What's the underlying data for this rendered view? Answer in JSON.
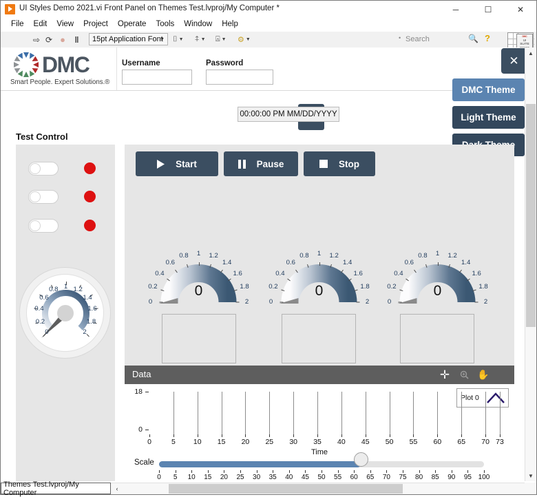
{
  "window": {
    "title": "UI Styles Demo 2021.vi Front Panel on Themes Test.lvproj/My Computer *",
    "app_icon": "labview-icon",
    "minimize": "─",
    "maximize": "☐",
    "close": "✕"
  },
  "menu": {
    "items": [
      "File",
      "Edit",
      "View",
      "Project",
      "Operate",
      "Tools",
      "Window",
      "Help"
    ]
  },
  "toolbar": {
    "run": "⇨",
    "run_continuous": "⟳",
    "abort": "●",
    "pause": "‖",
    "font_selector": "15pt Application Font",
    "caret": "▼",
    "align_objects": "⌷",
    "distribute_objects": "⍏",
    "resize_objects": "⍓",
    "reorder": "⚙",
    "search_divider": "•",
    "search_placeholder": "Search",
    "search_icon": "search-icon",
    "help_icon": "?",
    "vi_icon_line1": "UI",
    "vi_icon_line2": "SUITE",
    "vi_icon_line3": "DEMO",
    "vi_icon_brand": "DMC"
  },
  "header": {
    "logo_text": "DMC",
    "logo_tagline": "Smart People. Expert Solutions.®",
    "username_label": "Username",
    "username_value": "",
    "password_label": "Password",
    "password_value": "",
    "user_button_icon": "user-icon",
    "timestamp": "00:00:00 PM MM/DD/YYYY",
    "close_button": "✕"
  },
  "themes": {
    "buttons": [
      {
        "label": "DMC Theme",
        "color": "#5b84b1",
        "selected": true
      },
      {
        "label": "Light Theme",
        "color": "#33475c",
        "selected": false
      },
      {
        "label": "Dark Theme",
        "color": "#33475c",
        "selected": false
      }
    ]
  },
  "test_control": {
    "title": "Test Control",
    "toggles": [
      {
        "state": "off"
      },
      {
        "state": "off"
      },
      {
        "state": "off"
      }
    ],
    "leds": [
      {
        "color": "#dd1111",
        "state": "on"
      },
      {
        "color": "#dd1111",
        "state": "on"
      },
      {
        "color": "#dd1111",
        "state": "on"
      }
    ],
    "knob": {
      "value": 0,
      "min": 0,
      "max": 2,
      "tick_labels": [
        "0",
        "0.2",
        "0.4",
        "0.6",
        "0.8",
        "1",
        "1.2",
        "1.4",
        "1.6",
        "1.8",
        "2"
      ]
    }
  },
  "controls": {
    "start": {
      "label": "Start",
      "icon": "play-icon"
    },
    "pause": {
      "label": "Pause",
      "icon": "pause-icon"
    },
    "stop": {
      "label": "Stop",
      "icon": "stop-icon"
    }
  },
  "gauges": [
    {
      "value": "0",
      "min": 0,
      "max": 2,
      "tick_labels": [
        "0",
        "0.2",
        "0.4",
        "0.6",
        "0.8",
        "1",
        "1.2",
        "1.4",
        "1.6",
        "1.8",
        "2"
      ]
    },
    {
      "value": "0",
      "min": 0,
      "max": 2,
      "tick_labels": [
        "0",
        "0.2",
        "0.4",
        "0.6",
        "0.8",
        "1",
        "1.2",
        "1.4",
        "1.6",
        "1.8",
        "2"
      ]
    },
    {
      "value": "0",
      "min": 0,
      "max": 2,
      "tick_labels": [
        "0",
        "0.2",
        "0.4",
        "0.6",
        "0.8",
        "1",
        "1.2",
        "1.4",
        "1.6",
        "1.8",
        "2"
      ]
    }
  ],
  "graph": {
    "title": "Data",
    "tools": [
      {
        "name": "cursor-move-icon",
        "glyph": "✛",
        "active": true
      },
      {
        "name": "zoom-icon",
        "glyph": "⚲",
        "active": false
      },
      {
        "name": "pan-hand-icon",
        "glyph": "✋",
        "active": false
      }
    ],
    "legend_label": "Plot 0",
    "x_title": "Time"
  },
  "chart_data": {
    "type": "line",
    "title": "Data",
    "xlabel": "Time",
    "ylabel": "",
    "x_ticks": [
      0,
      5,
      10,
      15,
      20,
      25,
      30,
      35,
      40,
      45,
      50,
      55,
      60,
      65,
      70,
      73
    ],
    "y_ticks": [
      0,
      18
    ],
    "xlim": [
      0,
      73
    ],
    "ylim": [
      0,
      18
    ],
    "grid": true,
    "legend_position": "top-right",
    "series": [
      {
        "name": "Plot 0",
        "color": "#2a1a6b",
        "x": [],
        "values": []
      }
    ]
  },
  "scale": {
    "label": "Scale",
    "value": 62,
    "min": 0,
    "max": 100,
    "tick_labels": [
      "0",
      "5",
      "10",
      "15",
      "20",
      "25",
      "30",
      "35",
      "40",
      "45",
      "50",
      "55",
      "60",
      "65",
      "70",
      "75",
      "80",
      "85",
      "90",
      "95",
      "100"
    ]
  },
  "status": {
    "text": "Themes Test.lvproj/My Computer",
    "h_arrow": "‹"
  }
}
